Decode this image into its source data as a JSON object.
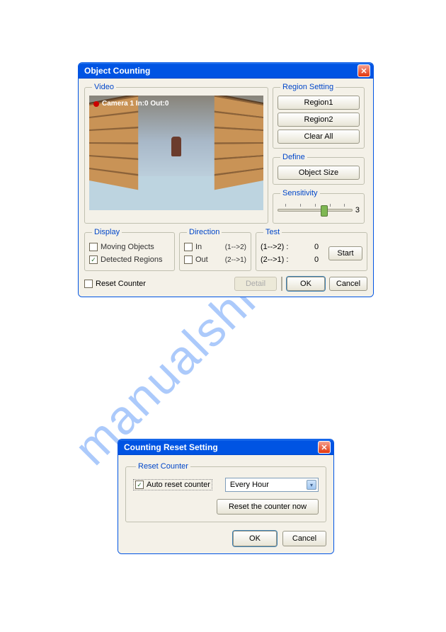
{
  "watermark": "manualshive.com",
  "dialog1": {
    "title": "Object Counting",
    "video": {
      "legend": "Video",
      "overlay": "Camera 1 In:0 Out:0"
    },
    "region": {
      "legend": "Region Setting",
      "region1": "Region1",
      "region2": "Region2",
      "clearAll": "Clear All"
    },
    "define": {
      "legend": "Define",
      "objectSize": "Object Size"
    },
    "sensitivity": {
      "legend": "Sensitivity",
      "value": "3"
    },
    "display": {
      "legend": "Display",
      "movingObjects": "Moving Objects",
      "detectedRegions": "Detected Regions"
    },
    "direction": {
      "legend": "Direction",
      "in": "In",
      "inArrow": "(1-->2)",
      "out": "Out",
      "outArrow": "(2-->1)"
    },
    "test": {
      "legend": "Test",
      "row1": "(1-->2) :",
      "val1": "0",
      "row2": "(2-->1) :",
      "val2": "0",
      "start": "Start"
    },
    "footer": {
      "resetCounter": "Reset Counter",
      "detail": "Detail",
      "ok": "OK",
      "cancel": "Cancel"
    }
  },
  "dialog2": {
    "title": "Counting Reset Setting",
    "group": {
      "legend": "Reset Counter",
      "auto": "Auto reset counter",
      "interval": "Every Hour",
      "resetNow": "Reset the counter now"
    },
    "ok": "OK",
    "cancel": "Cancel"
  }
}
